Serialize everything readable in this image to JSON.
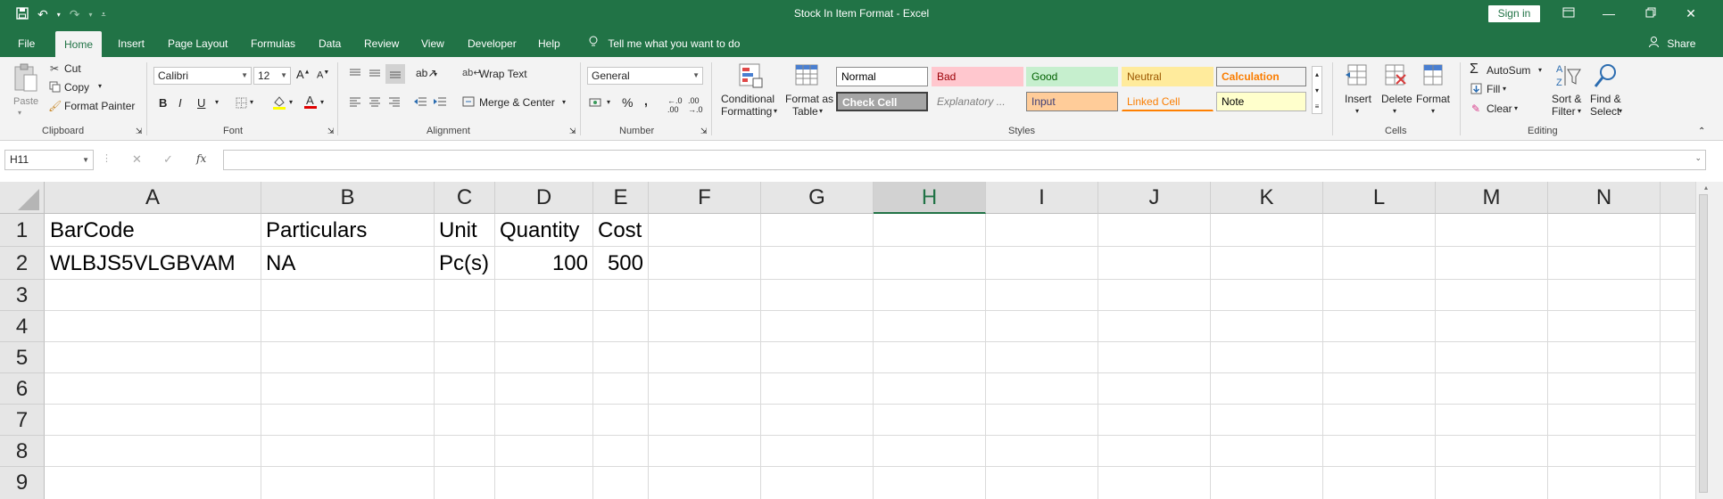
{
  "title_bar": {
    "document_title": "Stock In Item Format  -  Excel",
    "sign_in_label": "Sign in",
    "icons": [
      "save-icon",
      "undo-icon",
      "redo-icon",
      "customize-qat-icon",
      "ribbon-display-icon",
      "minimize-icon",
      "restore-icon",
      "close-icon"
    ]
  },
  "tabs": [
    "File",
    "Home",
    "Insert",
    "Page Layout",
    "Formulas",
    "Data",
    "Review",
    "View",
    "Developer",
    "Help"
  ],
  "active_tab": "Home",
  "tell_me": "Tell me what you want to do",
  "share_label": "Share",
  "ribbon": {
    "clipboard": {
      "paste": "Paste",
      "cut": "Cut",
      "copy": "Copy",
      "format_painter": "Format Painter",
      "label": "Clipboard"
    },
    "font": {
      "family": "Calibri",
      "size": "12",
      "bold": "B",
      "italic": "I",
      "underline": "U",
      "label": "Font"
    },
    "alignment": {
      "wrap_text": "Wrap Text",
      "merge_center": "Merge & Center",
      "label": "Alignment"
    },
    "number": {
      "format": "General",
      "percent": "%",
      "comma": ",",
      "label": "Number"
    },
    "styles": {
      "conditional_1": "Conditional",
      "conditional_2": "Formatting",
      "format_table_1": "Format as",
      "format_table_2": "Table",
      "cells": [
        "Normal",
        "Bad",
        "Good",
        "Neutral",
        "Calculation",
        "Check Cell",
        "Explanatory ...",
        "Input",
        "Linked Cell",
        "Note"
      ],
      "label": "Styles"
    },
    "cells": {
      "insert": "Insert",
      "delete": "Delete",
      "format": "Format",
      "label": "Cells"
    },
    "editing": {
      "autosum": "AutoSum",
      "fill": "Fill",
      "clear": "Clear",
      "sort_1": "Sort &",
      "sort_2": "Filter",
      "find_1": "Find &",
      "find_2": "Select",
      "label": "Editing"
    }
  },
  "formula_bar": {
    "name_box": "H11",
    "fx": "fx",
    "value": ""
  },
  "sheet": {
    "columns": [
      "A",
      "B",
      "C",
      "D",
      "E",
      "F",
      "G",
      "H",
      "I",
      "J",
      "K",
      "L",
      "M",
      "N"
    ],
    "selected_column": "H",
    "rows": [
      "1",
      "2",
      "3",
      "4",
      "5",
      "6",
      "7",
      "8",
      "9"
    ],
    "data": [
      [
        "BarCode",
        "Particulars",
        "Unit",
        "Quantity",
        "Cost"
      ],
      [
        "WLBJS5VLGBVAM",
        "NA",
        "Pc(s)",
        "100",
        "500"
      ]
    ]
  },
  "colors": {
    "excel_green": "#217346",
    "ribbon_bg": "#f3f3f3"
  }
}
